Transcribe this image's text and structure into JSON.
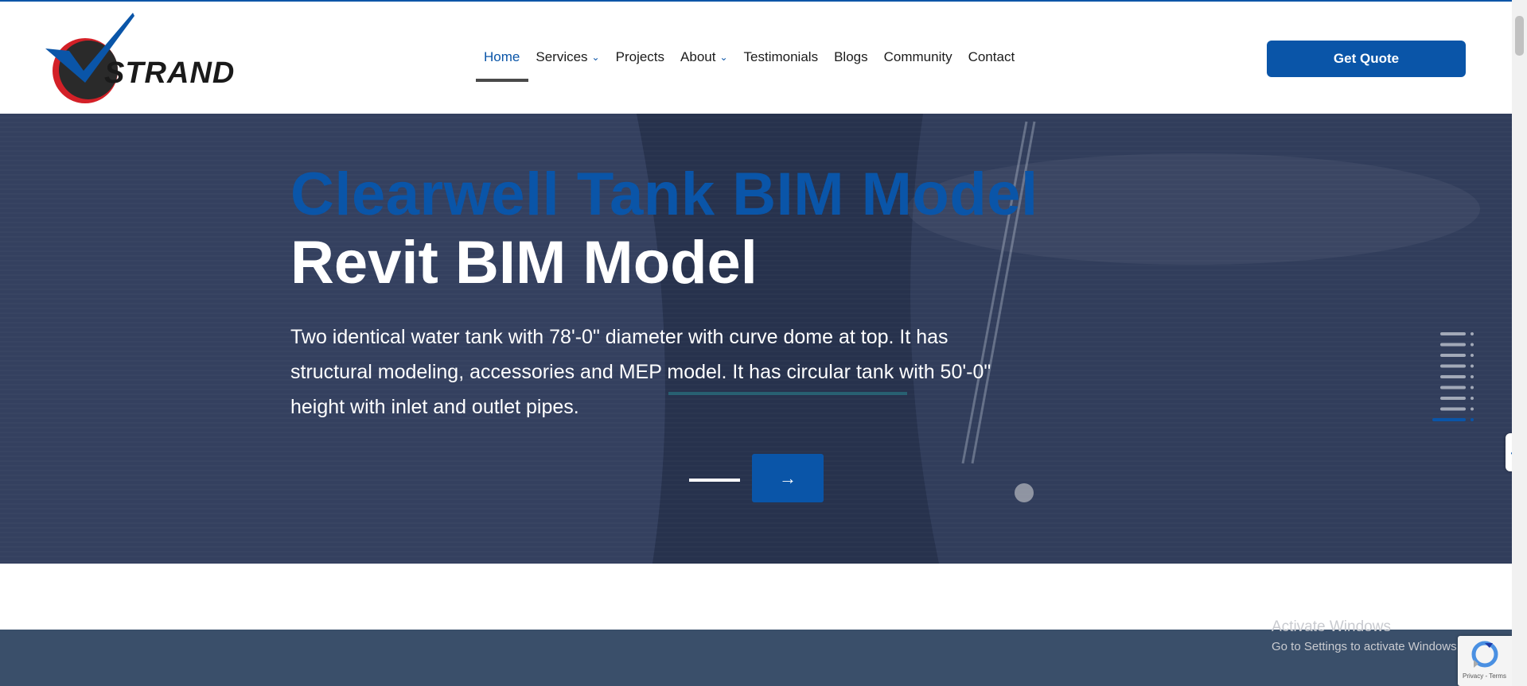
{
  "brand": {
    "logo_text": "STRAND",
    "accent": "#0a55a8",
    "logo_red": "#d32027"
  },
  "nav": {
    "items": [
      {
        "label": "Home",
        "active": true,
        "dropdown": false
      },
      {
        "label": "Services",
        "active": false,
        "dropdown": true
      },
      {
        "label": "Projects",
        "active": false,
        "dropdown": false
      },
      {
        "label": "About",
        "active": false,
        "dropdown": true
      },
      {
        "label": "Testimonials",
        "active": false,
        "dropdown": false
      },
      {
        "label": "Blogs",
        "active": false,
        "dropdown": false
      },
      {
        "label": "Community",
        "active": false,
        "dropdown": false
      },
      {
        "label": "Contact",
        "active": false,
        "dropdown": false
      }
    ]
  },
  "header": {
    "cta_label": "Get Quote"
  },
  "hero": {
    "title_line1": "Clearwell Tank BIM Model",
    "title_line2": "Revit BIM Model",
    "description": "Two identical water tank with 78'-0\" diameter with curve dome at top. It has structural modeling, accessories and MEP model. It has circular tank with 50'-0\" height with inlet and outlet pipes.",
    "next_arrow": "→",
    "slide_count": 9,
    "active_slide": 9
  },
  "side_tab": {
    "icon": "chevron-left-icon",
    "glyph": "❮"
  },
  "os_overlay": {
    "activate_title": "Activate Windows",
    "activate_subtitle": "Go to Settings to activate Windows."
  },
  "recaptcha": {
    "text": "Privacy - Terms"
  }
}
